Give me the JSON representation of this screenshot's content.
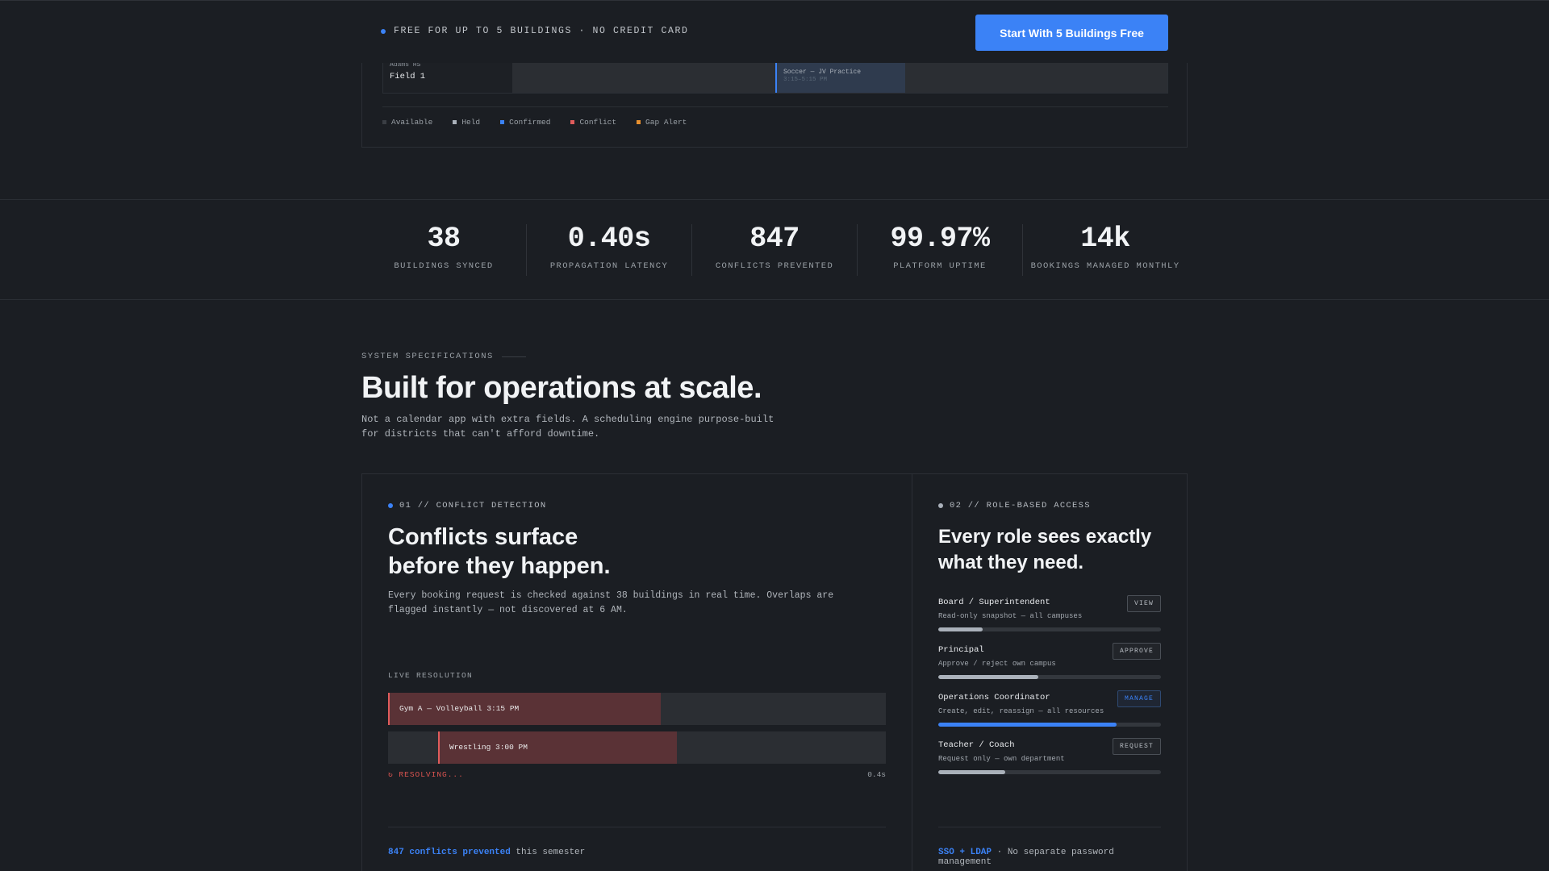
{
  "topbar": {
    "free_text": "FREE FOR UP TO 5 BUILDINGS · NO CREDIT CARD",
    "cta_label": "Start With 5 Buildings Free"
  },
  "schedule": {
    "campus": "Adams HS",
    "field": "Field 1",
    "booking_title": "Soccer — JV Practice",
    "booking_time": "3:15–5:15 PM",
    "legend": [
      {
        "label": "Available",
        "color": "#3a3e44"
      },
      {
        "label": "Held",
        "color": "#aab1ba"
      },
      {
        "label": "Confirmed",
        "color": "#3b82f6"
      },
      {
        "label": "Conflict",
        "color": "#e05c5c"
      },
      {
        "label": "Gap Alert",
        "color": "#e8902f"
      }
    ]
  },
  "stats": [
    {
      "value": "38",
      "label": "BUILDINGS SYNCED"
    },
    {
      "value": "0.40s",
      "label": "PROPAGATION LATENCY"
    },
    {
      "value": "847",
      "label": "CONFLICTS PREVENTED"
    },
    {
      "value": "99.97%",
      "label": "PLATFORM UPTIME"
    },
    {
      "value": "14k",
      "label": "BOOKINGS MANAGED MONTHLY"
    }
  ],
  "specs": {
    "kicker": "SYSTEM SPECIFICATIONS",
    "title": "Built for operations at scale.",
    "subtitle": "Not a calendar app with extra fields. A scheduling engine purpose-built for districts that can't afford downtime."
  },
  "conflict": {
    "tag": "01 // CONFLICT DETECTION",
    "title_line1": "Conflicts surface",
    "title_line2": "before they happen.",
    "body": "Every booking request is checked against 38 buildings in real time. Overlaps are flagged instantly — not discovered at 6 AM.",
    "live_label": "LIVE RESOLUTION",
    "bar1_label": "Gym A — Volleyball 3:15 PM",
    "bar2_label": "Wrestling 3:00 PM",
    "resolving": "↻ RESOLVING...",
    "latency": "0.4s",
    "footer_strong": "847 conflicts prevented",
    "footer_rest": " this semester"
  },
  "roles": {
    "tag": "02 // ROLE-BASED ACCESS",
    "title_line1": "Every role sees exactly",
    "title_line2": "what they need.",
    "items": [
      {
        "name": "Board / Superintendent",
        "desc": "Read-only snapshot — all campuses",
        "badge": "VIEW",
        "level": 0.2
      },
      {
        "name": "Principal",
        "desc": "Approve / reject own campus",
        "badge": "APPROVE",
        "level": 0.45
      },
      {
        "name": "Operations Coordinator",
        "desc": "Create, edit, reassign — all resources",
        "badge": "MANAGE",
        "level": 0.8
      },
      {
        "name": "Teacher / Coach",
        "desc": "Request only — own department",
        "badge": "REQUEST",
        "level": 0.3
      }
    ],
    "footer_strong": "SSO + LDAP",
    "footer_rest": " · No separate password management"
  }
}
